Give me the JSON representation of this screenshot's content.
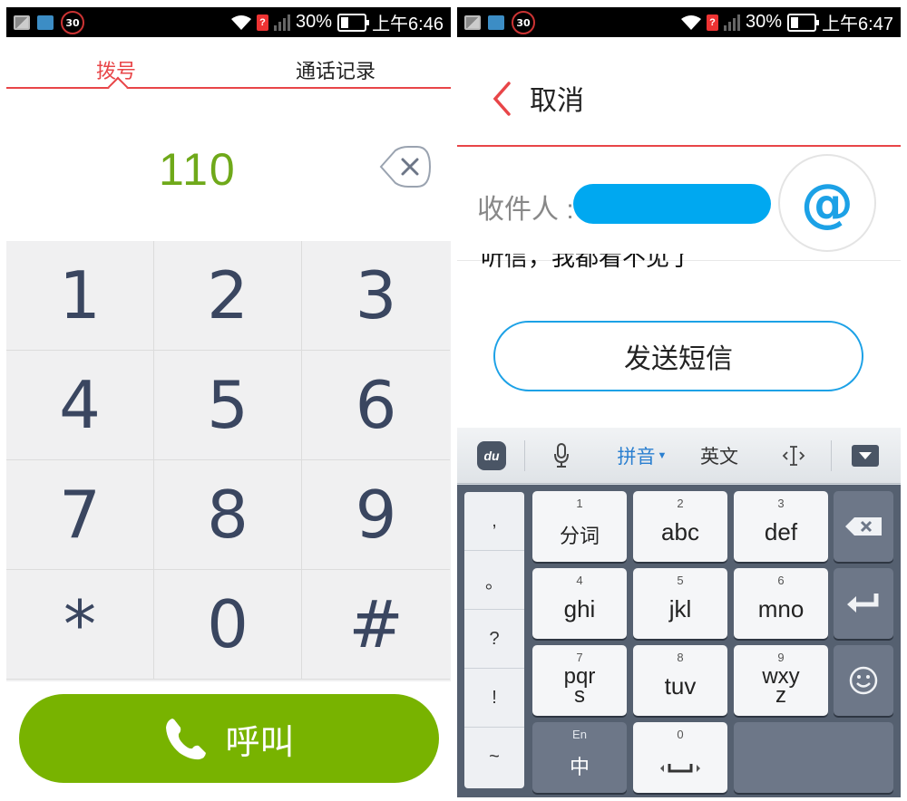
{
  "left_screen": {
    "status": {
      "speed": "30",
      "battery": "30%",
      "time": "上午6:46"
    },
    "tabs": [
      {
        "label": "拨号",
        "active": true
      },
      {
        "label": "通话记录",
        "active": false
      }
    ],
    "dial_number": "110",
    "keys": [
      "1",
      "2",
      "3",
      "4",
      "5",
      "6",
      "7",
      "8",
      "9",
      "*",
      "0",
      "#"
    ],
    "call_label": "呼叫",
    "accent": "#e84548",
    "call_color": "#78b300"
  },
  "right_screen": {
    "status": {
      "speed": "30",
      "battery": "30%",
      "time": "上午6:47"
    },
    "cancel_label": "取消",
    "recipient_label": "收件人 :",
    "at_symbol": "@",
    "message_text": "听信，我都看不见了",
    "send_label": "发送短信",
    "keyboard": {
      "logo": "du",
      "toolbar": {
        "pinyin": "拼音",
        "english": "英文"
      },
      "punctuation": [
        ",",
        "。",
        "?",
        "!",
        "~"
      ],
      "keys": [
        {
          "num": "1",
          "label": "分词"
        },
        {
          "num": "2",
          "label": "abc"
        },
        {
          "num": "3",
          "label": "def"
        },
        {
          "num": "4",
          "label": "ghi"
        },
        {
          "num": "5",
          "label": "jkl"
        },
        {
          "num": "6",
          "label": "mno"
        },
        {
          "num": "7",
          "label": "pqr s"
        },
        {
          "num": "8",
          "label": "tuv"
        },
        {
          "num": "9",
          "label": "wxy z"
        }
      ],
      "lang_key": {
        "top": "En",
        "label": "中"
      },
      "space_key_num": "0",
      "icons": [
        "microphone-icon",
        "cursor-icon",
        "hide-keyboard-icon",
        "backspace-icon",
        "enter-icon",
        "emoji-icon"
      ]
    }
  }
}
